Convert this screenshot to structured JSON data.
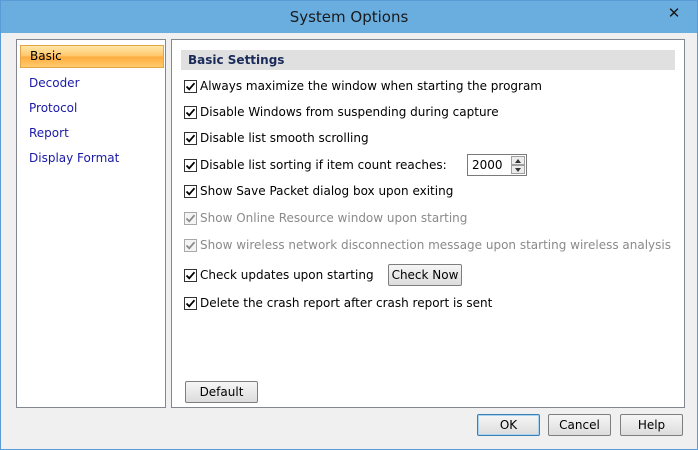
{
  "window": {
    "title": "System Options",
    "close_glyph": "✕",
    "accent_color": "#6aaee0"
  },
  "nav": {
    "items": [
      {
        "label": "Basic",
        "selected": true
      },
      {
        "label": "Decoder",
        "selected": false
      },
      {
        "label": "Protocol",
        "selected": false
      },
      {
        "label": "Report",
        "selected": false
      },
      {
        "label": "Display Format",
        "selected": false
      }
    ]
  },
  "basic_settings": {
    "header": "Basic Settings",
    "options": [
      {
        "label": "Always maximize the window when starting the program",
        "checked": true,
        "enabled": true
      },
      {
        "label": "Disable Windows from suspending during capture",
        "checked": true,
        "enabled": true
      },
      {
        "label": "Disable list smooth scrolling",
        "checked": true,
        "enabled": true
      },
      {
        "label": "Disable list sorting if item count reaches:",
        "checked": true,
        "enabled": true
      },
      {
        "label": "Show Save Packet dialog box upon exiting",
        "checked": true,
        "enabled": true
      },
      {
        "label": "Show Online Resource window upon starting",
        "checked": true,
        "enabled": false
      },
      {
        "label": "Show wireless network disconnection message upon starting wireless analysis",
        "checked": true,
        "enabled": false
      },
      {
        "label": "Check updates upon starting",
        "checked": true,
        "enabled": true
      },
      {
        "label": "Delete the crash report after crash report is sent",
        "checked": true,
        "enabled": true
      }
    ],
    "sort_limit_value": "2000",
    "check_now_label": "Check Now",
    "default_label": "Default"
  },
  "footer": {
    "ok_label": "OK",
    "cancel_label": "Cancel",
    "help_label": "Help"
  },
  "icons": [
    "close-icon",
    "checkmark-icon",
    "spin-up-arrow-icon",
    "spin-down-arrow-icon"
  ]
}
